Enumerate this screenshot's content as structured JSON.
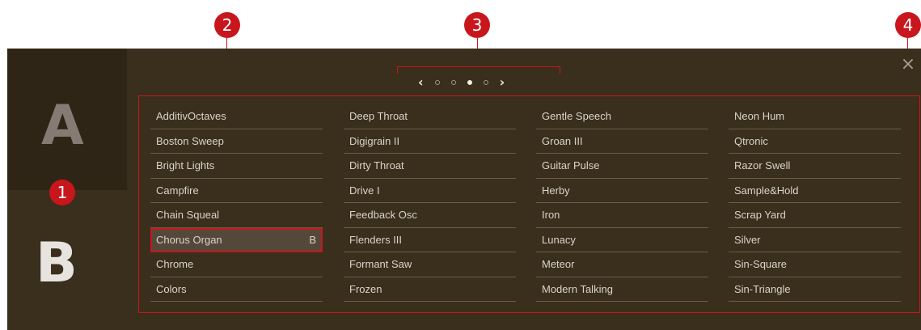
{
  "callouts": [
    "1",
    "2",
    "3",
    "4"
  ],
  "slots": {
    "a": "A",
    "b": "B"
  },
  "pager": {
    "prev": "‹",
    "next": "›",
    "pages": 4,
    "current_page": 3
  },
  "close_glyph": "×",
  "columns": [
    [
      "AdditivOctaves",
      "Boston Sweep",
      "Bright Lights",
      "Campfire",
      "Chain Squeal",
      "Chorus Organ",
      "Chrome",
      "Colors"
    ],
    [
      "Deep Throat",
      "Digigrain II",
      "Dirty Throat",
      "Drive I",
      "Feedback Osc",
      "Flenders III",
      "Formant Saw",
      "Frozen"
    ],
    [
      "Gentle Speech",
      "Groan III",
      "Guitar Pulse",
      "Herby",
      "Iron",
      "Lunacy",
      "Meteor",
      "Modern Talking"
    ],
    [
      "Neon Hum",
      "Qtronic",
      "Razor Swell",
      "Sample&Hold",
      "Scrap Yard",
      "Silver",
      "Sin-Square",
      "Sin-Triangle"
    ]
  ],
  "selected_tag": "B",
  "colors": {
    "accent": "#c8161d",
    "panel": "#3a2e1c",
    "slot_a_bg": "#2e2516"
  }
}
